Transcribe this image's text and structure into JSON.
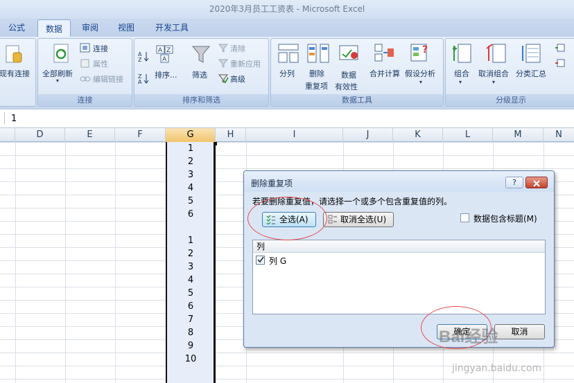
{
  "window": {
    "title": "2020年3月员工工资表 - Microsoft Excel"
  },
  "tabs": [
    {
      "label": "公式"
    },
    {
      "label": "数据"
    },
    {
      "label": "审阅"
    },
    {
      "label": "视图"
    },
    {
      "label": "开发工具"
    }
  ],
  "ribbon": {
    "groups": {
      "connections": "连接",
      "sort_filter": "排序和筛选",
      "data_tools": "数据工具",
      "outline": "分级显示"
    },
    "existing_connections": "现有连接",
    "refresh_all": "全部刷新",
    "connections": "连接",
    "properties": "属性",
    "edit_links": "编辑链接",
    "sort": "排序...",
    "filter": "筛选",
    "clear": "清除",
    "reapply": "重新应用",
    "advanced": "高级",
    "text_to_columns": "分列",
    "remove_duplicates_1": "删除",
    "remove_duplicates_2": "重复项",
    "data_validation_1": "数据",
    "data_validation_2": "有效性",
    "consolidate": "合并计算",
    "what_if": "假设分析",
    "group": "组合",
    "ungroup": "取消组合",
    "subtotal": "分类汇总"
  },
  "formula_bar": {
    "value": "1"
  },
  "columns": [
    "D",
    "E",
    "F",
    "G",
    "H",
    "I",
    "J",
    "K",
    "L",
    "M",
    "N"
  ],
  "column_g_values": [
    "1",
    "2",
    "3",
    "4",
    "5",
    "6",
    "",
    "1",
    "2",
    "3",
    "4",
    "5",
    "6",
    "7",
    "8",
    "9",
    "10"
  ],
  "dialog": {
    "title": "删除重复项",
    "help": "?",
    "instruction": "若要删除重复值，请选择一个或多个包含重复值的列。",
    "select_all": "全选(A)",
    "unselect_all": "取消全选(U)",
    "has_headers": "数据包含标题(M)",
    "list_header": "列",
    "list_items": [
      {
        "label": "列 G",
        "checked": true
      }
    ],
    "ok": "确定",
    "cancel": "取消"
  },
  "watermark": {
    "line1": "Bai经验",
    "line2": "jingyan.baidu.com"
  }
}
